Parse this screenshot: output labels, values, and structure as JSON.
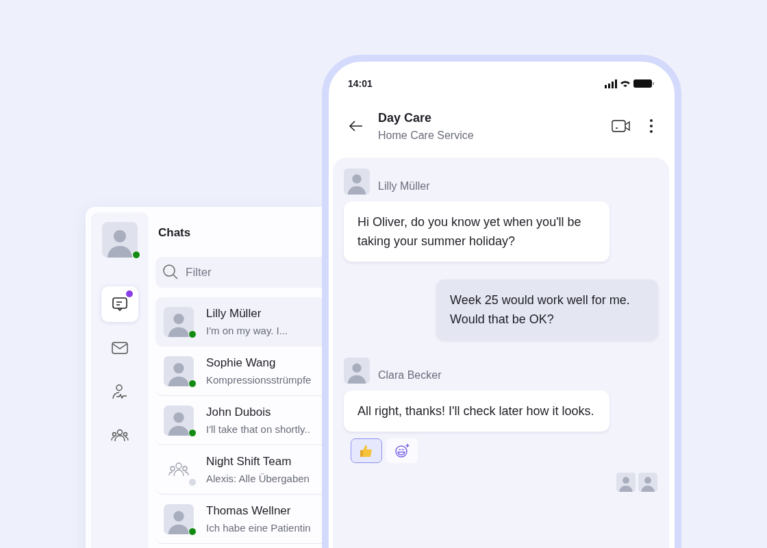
{
  "sidebar": {
    "profile": {
      "online": true
    },
    "items": [
      {
        "kind": "chat",
        "selected": true,
        "badge": true
      },
      {
        "kind": "mail",
        "selected": false,
        "badge": false
      },
      {
        "kind": "patient",
        "selected": false,
        "badge": false
      },
      {
        "kind": "group",
        "selected": false,
        "badge": false
      }
    ]
  },
  "chat_list": {
    "title": "Chats",
    "search": {
      "placeholder": "Filter"
    },
    "items": [
      {
        "kind": "person",
        "name": "Lilly Müller",
        "preview": "I'm on my way. I...",
        "online": true,
        "selected": true
      },
      {
        "kind": "person",
        "name": "Sophie Wang",
        "preview": "Kompressionsstrümpfe",
        "online": true,
        "selected": false
      },
      {
        "kind": "person",
        "name": "John Dubois",
        "preview": "I'll take that on shortly..",
        "online": true,
        "selected": false
      },
      {
        "kind": "group",
        "name": "Night Shift Team",
        "preview": "Alexis: Alle Übergaben",
        "online": false,
        "selected": false
      },
      {
        "kind": "person",
        "name": "Thomas Wellner",
        "preview": "Ich habe eine Patientin",
        "online": true,
        "selected": false
      }
    ]
  },
  "phone": {
    "status_bar": {
      "time": "14:01"
    },
    "header": {
      "title": "Day Care",
      "subtitle": "Home Care Service"
    },
    "messages": [
      {
        "kind": "incoming",
        "sender": "Lilly Müller",
        "text": "Hi Oliver, do you know yet when you'll be taking your summer holiday?"
      },
      {
        "kind": "outgoing",
        "text": "Week 25 would work well for me. Would that be OK?"
      },
      {
        "kind": "incoming",
        "sender": "Clara Becker",
        "text": "All right, thanks! I'll check later how it looks.",
        "reactions": [
          {
            "kind": "thumbs_up",
            "selected": true
          },
          {
            "kind": "add",
            "selected": false
          }
        ]
      }
    ]
  }
}
